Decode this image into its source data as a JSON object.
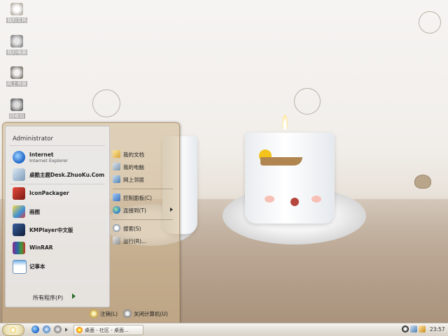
{
  "desktop_icons": [
    {
      "label": "我的文档",
      "icon": "my-documents-icon"
    },
    {
      "label": "我的电脑",
      "icon": "my-computer-icon"
    },
    {
      "label": "网上邻居",
      "icon": "network-places-icon"
    },
    {
      "label": "回收站",
      "icon": "recycle-bin-icon"
    }
  ],
  "start_menu": {
    "user": "Administrator",
    "pinned": [
      {
        "title": "Internet",
        "subtitle": "Internet Explorer",
        "icon": "internet-explorer-icon"
      },
      {
        "title": "桌酷主题Desk.ZhuoKu.Com",
        "icon": "zhuoku-theme-icon"
      }
    ],
    "recent": [
      {
        "title": "IconPackager",
        "icon": "iconpackager-icon"
      },
      {
        "title": "画图",
        "icon": "paint-icon"
      },
      {
        "title": "KMPlayer中文版",
        "icon": "kmplayer-icon"
      },
      {
        "title": "WinRAR",
        "icon": "winrar-icon"
      },
      {
        "title": "记事本",
        "icon": "notepad-icon"
      }
    ],
    "all_programs": "所有程序(P)",
    "right_items": {
      "my_docs": "我的文档",
      "my_computer": "我的电脑",
      "network": "网上邻居",
      "control_panel": "控制面板(C)",
      "connect_to": "连接到(T)",
      "search": "搜索(S)",
      "run": "运行(R)..."
    },
    "logoff": "注销(L)",
    "shutdown": "关闭计算机(U)"
  },
  "taskbar": {
    "task_title": "桌面 - 社区 - 桌面...",
    "clock": "23:57"
  },
  "colors": {
    "accent": "#2b6c2b",
    "menu_bg": "#cdb48c",
    "taskbar": "#e4e0d8"
  }
}
